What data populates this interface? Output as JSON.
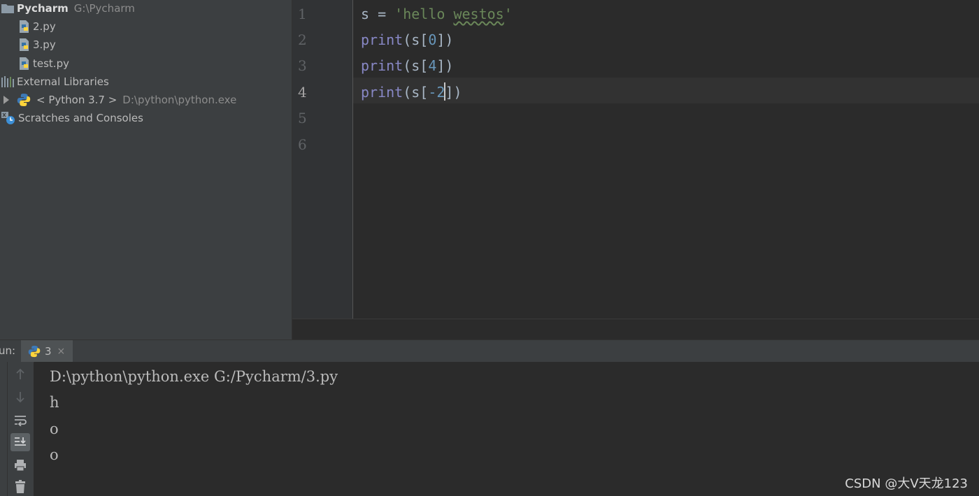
{
  "project_tree": {
    "root": {
      "label": "Pycharm",
      "hint": "G:\\Pycharm",
      "icon": "folder-icon"
    },
    "files": [
      {
        "label": "2.py",
        "icon": "python-file-icon"
      },
      {
        "label": "3.py",
        "icon": "python-file-icon"
      },
      {
        "label": "test.py",
        "icon": "python-file-icon"
      }
    ],
    "external_libraries": {
      "label": "External Libraries",
      "icon": "libraries-icon"
    },
    "python_sdk": {
      "label": "< Python 3.7 >",
      "hint": "D:\\python\\python.exe",
      "icon": "python-icon"
    },
    "scratches": {
      "label": "Scratches and Consoles",
      "icon": "scratches-icon"
    }
  },
  "editor": {
    "line_numbers": [
      "1",
      "2",
      "3",
      "4",
      "5",
      "6"
    ],
    "current_line": "4",
    "lines": [
      {
        "pre": "s = ",
        "str_open": "'hello ",
        "str_squig": "westos",
        "str_close": "'"
      },
      {
        "func": "print",
        "open": "(s[",
        "num": "0",
        "close": "])"
      },
      {
        "func": "print",
        "open": "(s[",
        "num": "4",
        "close": "])"
      },
      {
        "func": "print",
        "open": "(s[",
        "num": "-2",
        "close": "])"
      }
    ]
  },
  "run_panel": {
    "title": "un:",
    "tab_label": "3",
    "tab_close": "×",
    "output": [
      "D:\\python\\python.exe G:/Pycharm/3.py",
      "h",
      "o",
      "o"
    ]
  },
  "watermark": "CSDN @大V天龙123",
  "colors": {
    "keyword_print": "#8888c6",
    "string": "#6a8759",
    "number": "#6897bb",
    "default_text": "#a9b7c6"
  }
}
